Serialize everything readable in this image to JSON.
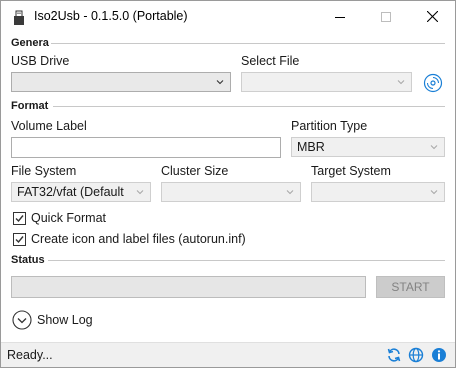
{
  "window": {
    "title": "Iso2Usb - 0.1.5.0 (Portable)"
  },
  "general": {
    "section_label": "Genera",
    "usb_drive_label": "USB Drive",
    "usb_drive_value": "",
    "select_file_label": "Select File",
    "select_file_value": ""
  },
  "format": {
    "section_label": "Format",
    "volume_label_label": "Volume Label",
    "volume_label_value": "",
    "partition_type_label": "Partition Type",
    "partition_type_value": "MBR",
    "file_system_label": "File System",
    "file_system_value": "FAT32/vfat (Default",
    "cluster_size_label": "Cluster Size",
    "cluster_size_value": "",
    "target_system_label": "Target System",
    "target_system_value": "",
    "quick_format_label": "Quick Format",
    "quick_format_checked": true,
    "create_icon_label": "Create icon and label files (autorun.inf)",
    "create_icon_checked": true
  },
  "status": {
    "section_label": "Status",
    "progress": 0,
    "start_label": "START",
    "show_log_label": "Show Log"
  },
  "statusbar": {
    "text": "Ready...",
    "icons": [
      "refresh-icon",
      "globe-icon",
      "info-icon"
    ]
  },
  "colors": {
    "accent": "#1a7fd6",
    "progress_track": "#e6e6e6",
    "statusbar_bg": "#f0f0f0"
  }
}
